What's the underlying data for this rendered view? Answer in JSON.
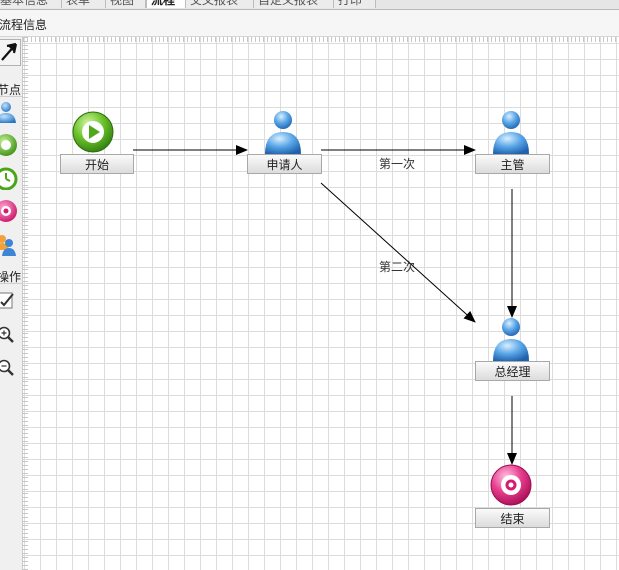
{
  "tabs": [
    {
      "label": "基本信息",
      "active": false
    },
    {
      "label": "表单",
      "active": false
    },
    {
      "label": "视图",
      "active": false
    },
    {
      "label": "流程",
      "active": true
    },
    {
      "label": "交叉报表",
      "active": false
    },
    {
      "label": "自定义报表",
      "active": false
    },
    {
      "label": "打印",
      "active": false
    }
  ],
  "info_title": "流程信息",
  "palette": {
    "nodes_section": "节点",
    "ops_section": "操作",
    "tools": {
      "select": "pointer-arrow-icon",
      "person": "person-icon",
      "start": "start-icon",
      "timer": "timer-icon",
      "end": "end-icon",
      "group": "group-icon",
      "edit": "edit-icon",
      "zoom_in": "zoom-in-icon",
      "zoom_out": "zoom-out-icon"
    }
  },
  "nodes": {
    "start": {
      "label": "开始",
      "icon": "start-icon"
    },
    "applicant": {
      "label": "申请人",
      "icon": "person-icon"
    },
    "supervisor": {
      "label": "主管",
      "icon": "person-icon"
    },
    "manager": {
      "label": "总经理",
      "icon": "person-icon"
    },
    "end": {
      "label": "结束",
      "icon": "end-icon"
    }
  },
  "edges": {
    "first": "第一次",
    "second": "第二次"
  },
  "colors": {
    "start": "#3f9e1a",
    "person": "#2f7fcf",
    "end": "#d81a72",
    "grid": "#dcdcdc"
  }
}
